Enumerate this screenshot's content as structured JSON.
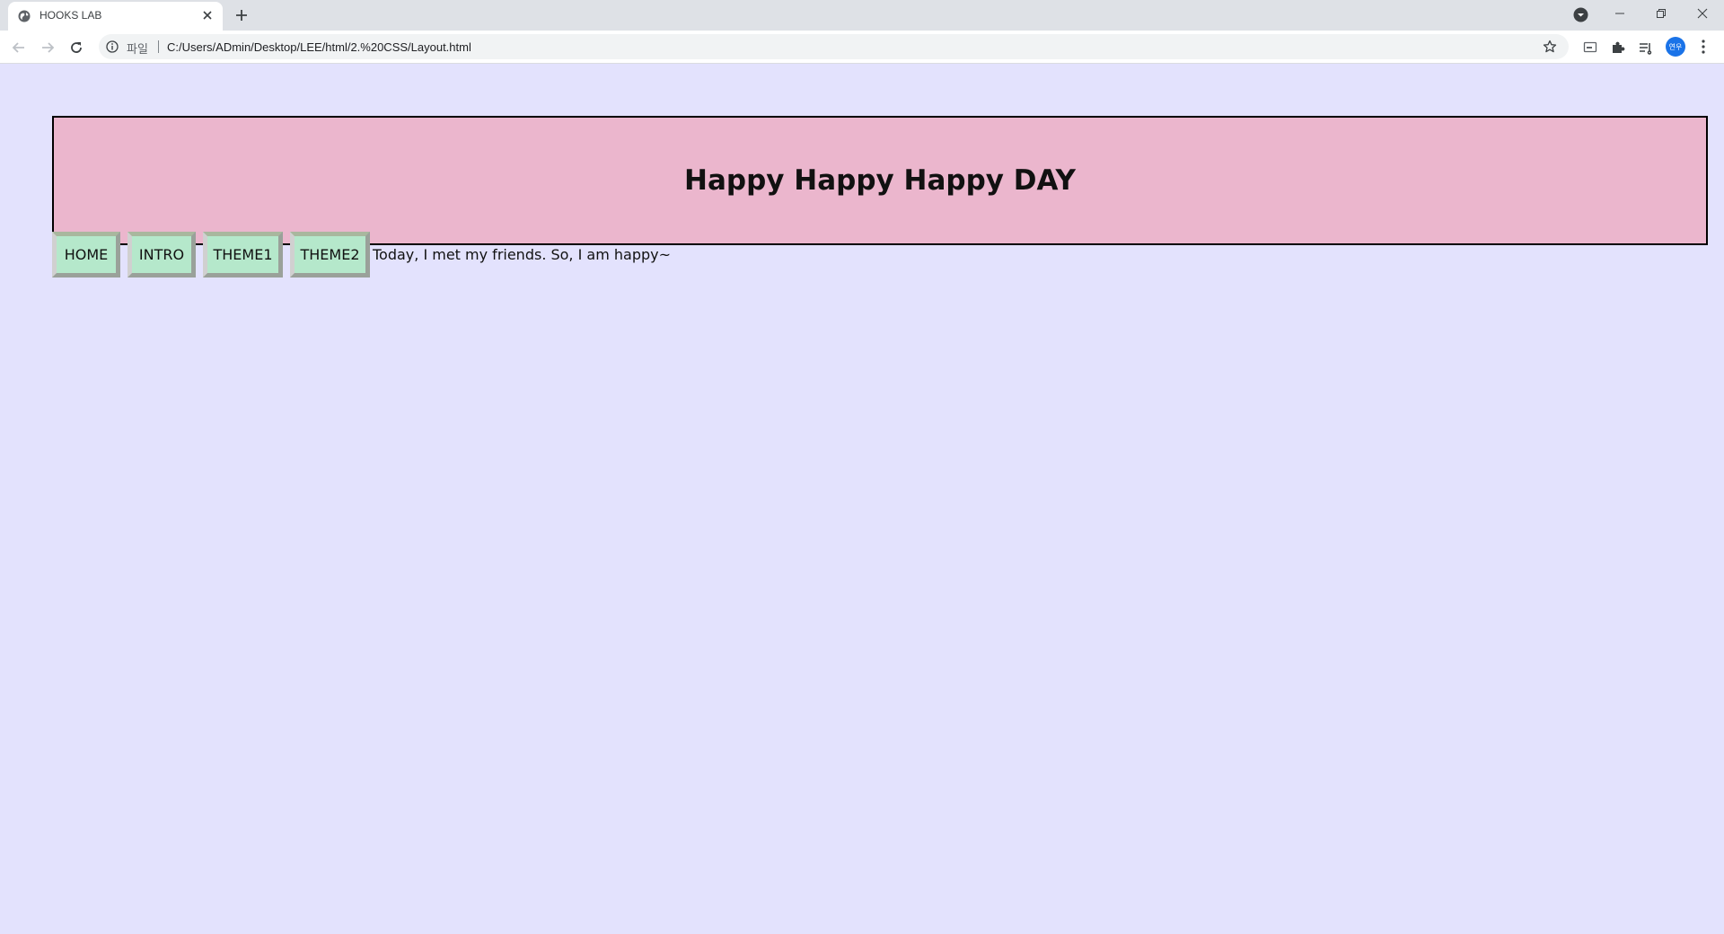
{
  "browser": {
    "tab_title": "HOOKS LAB",
    "scheme_label": "파일",
    "url": "C:/Users/ADmin/Desktop/LEE/html/2.%20CSS/Layout.html",
    "avatar_text": "연우"
  },
  "icons": {
    "favicon": "globe-icon",
    "tab_close": "close-icon",
    "new_tab": "plus-icon",
    "back": "arrow-left-icon",
    "forward": "arrow-right-icon",
    "reload": "reload-icon",
    "site_info": "info-icon",
    "bookmark": "star-icon",
    "extensions": "puzzle-icon",
    "menu": "kebab-icon"
  },
  "page": {
    "title": "Happy Happy Happy DAY",
    "nav": [
      "HOME",
      "INTRO",
      "THEME1",
      "THEME2"
    ],
    "body_text": "Today, I met my friends. So, I am happy~"
  },
  "colors": {
    "background": "#e3e2fd",
    "header_bg": "#ebb6cd",
    "nav_bg": "#b5e8cb"
  }
}
